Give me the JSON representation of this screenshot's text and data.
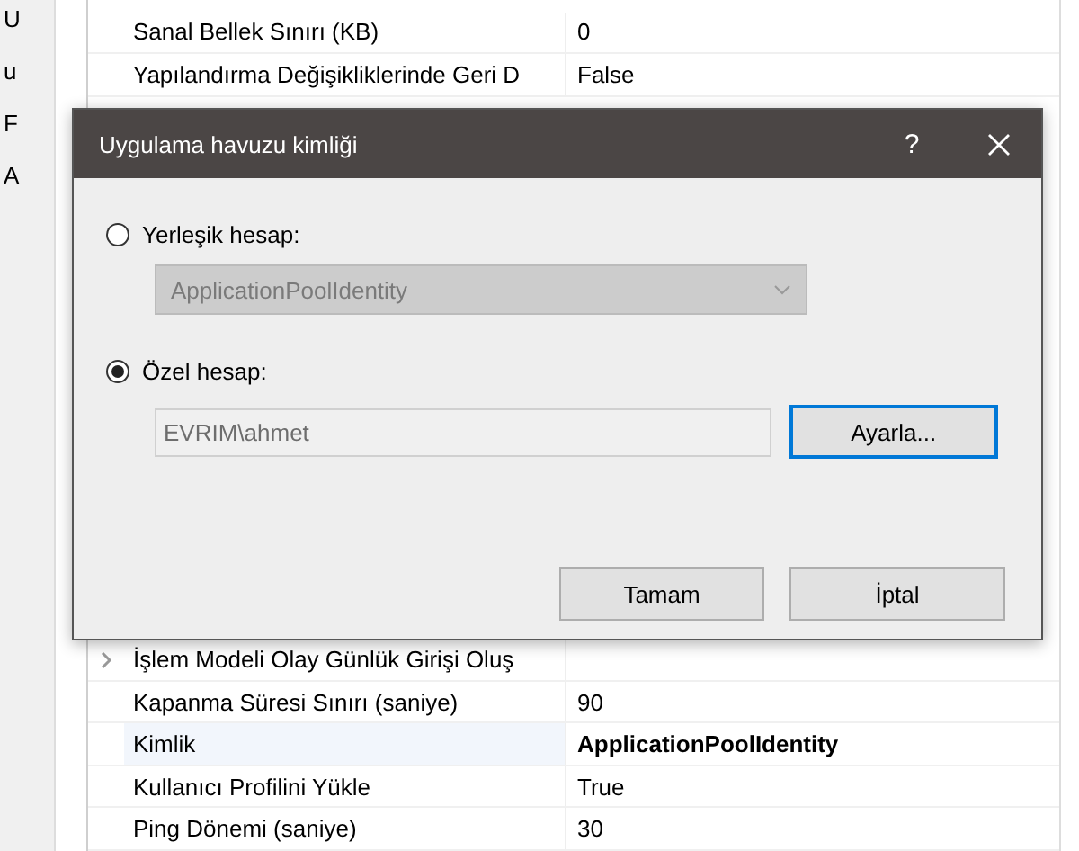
{
  "side_letters": [
    "U",
    "u",
    "F",
    "A"
  ],
  "properties_top": [
    {
      "name": "Sanal Bellek Sınırı (KB)",
      "value": "0",
      "bold": false,
      "selected": false,
      "expandable": false
    },
    {
      "name": "Yapılandırma Değişikliklerinde Geri D",
      "value": "False",
      "bold": false,
      "selected": false,
      "expandable": false
    }
  ],
  "properties_bottom": [
    {
      "name": "İşlem Modeli Olay Günlük Girişi Oluş",
      "selected": false,
      "expandable": true
    },
    {
      "name": "Kapanma Süresi Sınırı (saniye)",
      "value": "90",
      "bold": false,
      "selected": false,
      "expandable": false
    },
    {
      "name": "Kimlik",
      "value": "ApplicationPoolIdentity",
      "bold": true,
      "selected": true,
      "expandable": false
    },
    {
      "name": "Kullanıcı Profilini Yükle",
      "value": "True",
      "bold": false,
      "selected": false,
      "expandable": false
    },
    {
      "name": "Ping Dönemi (saniye)",
      "value": "30",
      "bold": false,
      "selected": false,
      "expandable": false
    }
  ],
  "dialog": {
    "title": "Uygulama havuzu kimliği",
    "help": "?",
    "options": [
      {
        "label": "Yerleşik hesap:",
        "selected": false
      },
      {
        "label": "Özel hesap:",
        "selected": true
      }
    ],
    "builtin_select": {
      "value": "ApplicationPoolIdentity",
      "disabled": true
    },
    "custom_field": {
      "value": "EVRIM\\ahmet",
      "disabled": true
    },
    "set_button": "Ayarla...",
    "buttons": [
      "Tamam",
      "İptal"
    ]
  }
}
